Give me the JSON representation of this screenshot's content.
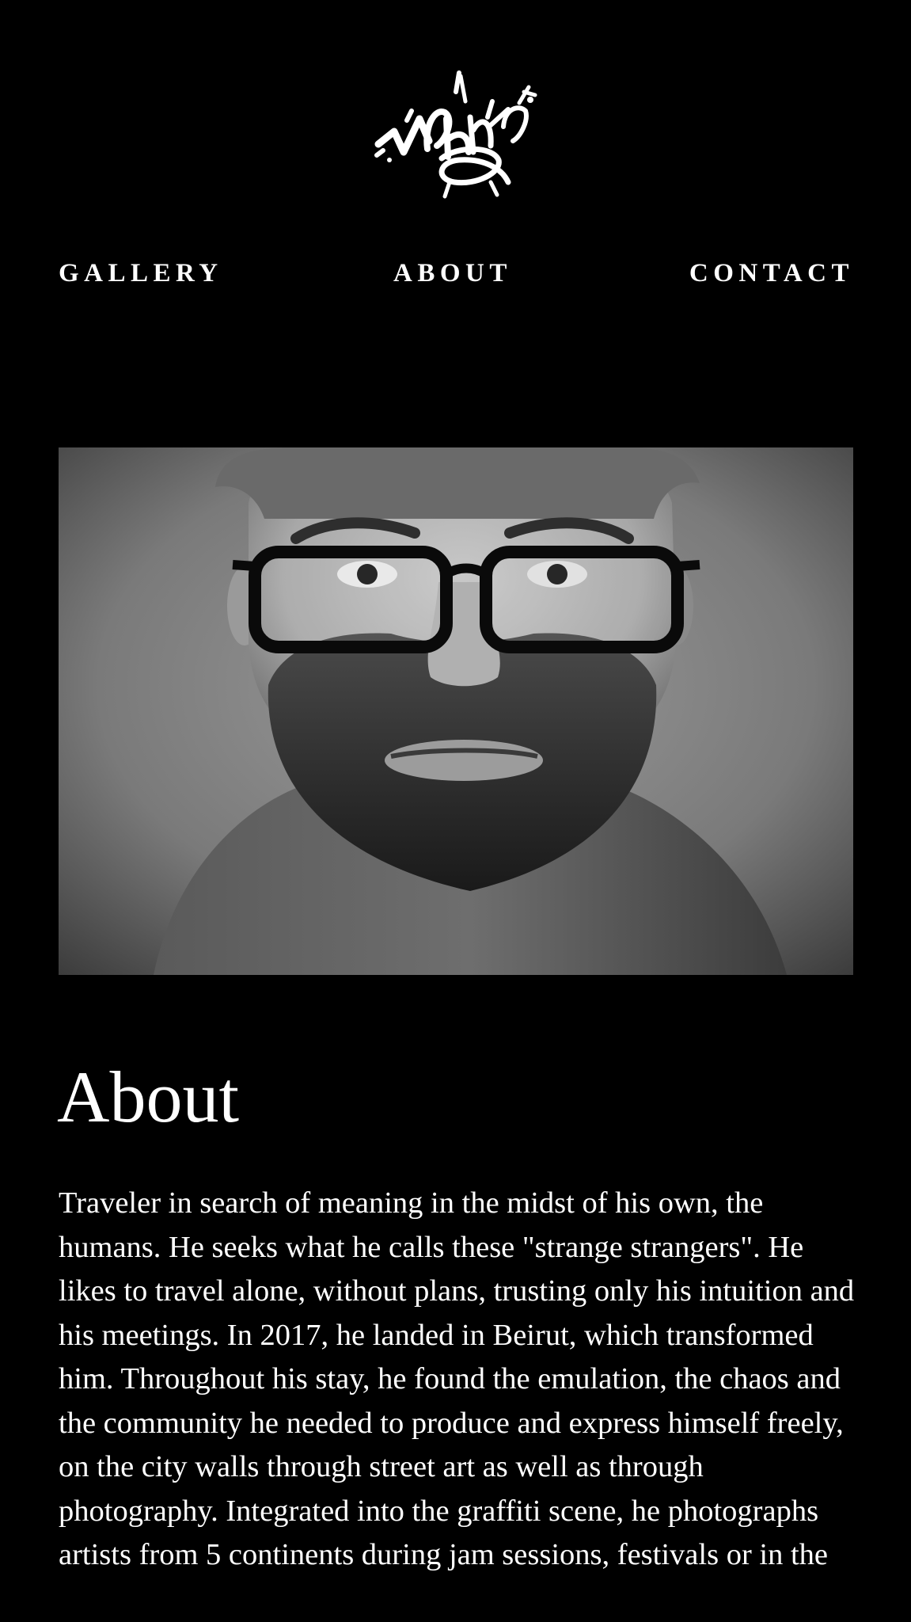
{
  "header": {
    "logo_icon": "graffiti-tag-logo"
  },
  "nav": {
    "gallery_label": "GALLERY",
    "about_label": "ABOUT",
    "contact_label": "CONTACT"
  },
  "portrait": {
    "icon": "portrait-photo-bearded-man-glasses"
  },
  "main": {
    "title": "About",
    "bio_text": "Traveler in search of meaning in the midst of his own, the humans. He seeks what he calls these \"strange strangers\". He likes to travel alone, without plans, trusting only his intuition and his meetings. In 2017, he landed in Beirut, which transformed him. Throughout his stay, he found the emulation, the chaos and the community he needed to produce and express himself freely, on the city walls through street art as well as through photography. Integrated into the graffiti scene, he photographs artists from 5 continents during jam sessions, festivals or in the"
  },
  "colors": {
    "background": "#000000",
    "text": "#ffffff"
  }
}
